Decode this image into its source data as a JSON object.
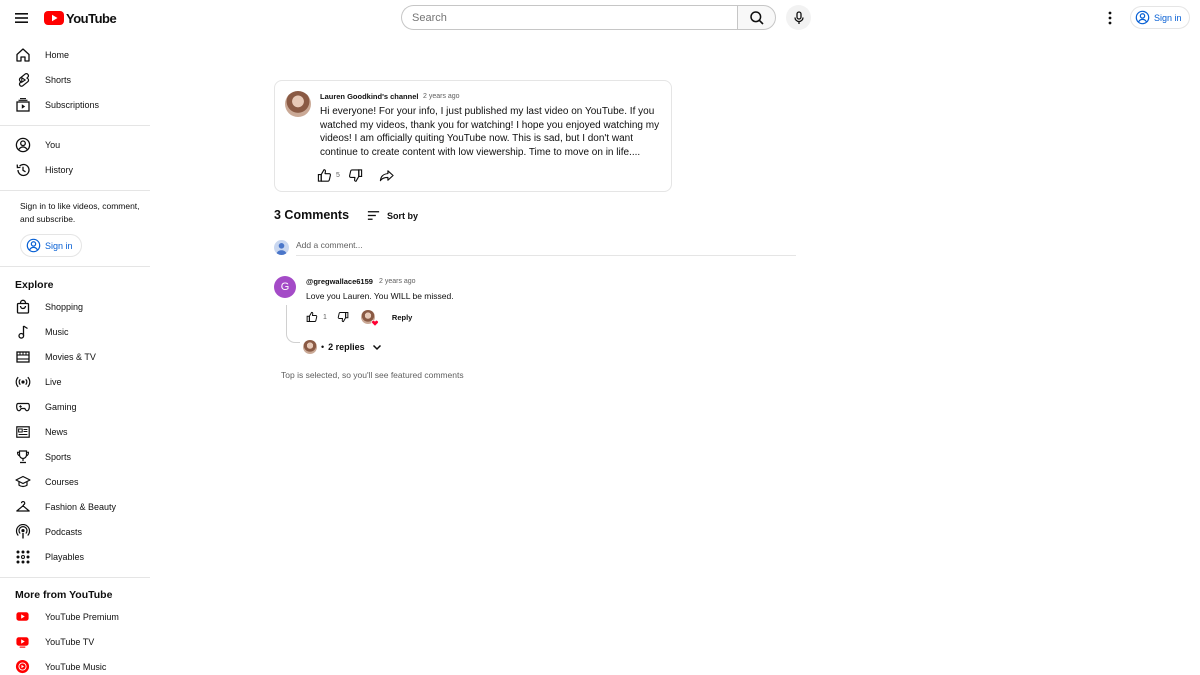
{
  "header": {
    "logo_text": "YouTube",
    "search_placeholder": "Search",
    "signin_label": "Sign in",
    "brand_color": "#ff0000",
    "link_color": "#065fd4"
  },
  "sidebar": {
    "primary": [
      {
        "label": "Home",
        "icon": "home-icon"
      },
      {
        "label": "Shorts",
        "icon": "shorts-icon"
      },
      {
        "label": "Subscriptions",
        "icon": "subscriptions-icon"
      }
    ],
    "you": [
      {
        "label": "You",
        "icon": "account-icon"
      },
      {
        "label": "History",
        "icon": "history-icon"
      }
    ],
    "signin_prompt": "Sign in to like videos, comment, and subscribe.",
    "signin_label": "Sign in",
    "explore_title": "Explore",
    "explore": [
      {
        "label": "Shopping",
        "icon": "shopping-icon"
      },
      {
        "label": "Music",
        "icon": "music-icon"
      },
      {
        "label": "Movies & TV",
        "icon": "movies-icon"
      },
      {
        "label": "Live",
        "icon": "live-icon"
      },
      {
        "label": "Gaming",
        "icon": "gaming-icon"
      },
      {
        "label": "News",
        "icon": "news-icon"
      },
      {
        "label": "Sports",
        "icon": "sports-icon"
      },
      {
        "label": "Courses",
        "icon": "courses-icon"
      },
      {
        "label": "Fashion & Beauty",
        "icon": "fashion-icon"
      },
      {
        "label": "Podcasts",
        "icon": "podcasts-icon"
      },
      {
        "label": "Playables",
        "icon": "playables-icon"
      }
    ],
    "more_title": "More from YouTube",
    "more": [
      {
        "label": "YouTube Premium",
        "icon": "youtube-premium-icon"
      },
      {
        "label": "YouTube TV",
        "icon": "youtube-tv-icon"
      },
      {
        "label": "YouTube Music",
        "icon": "youtube-music-icon"
      }
    ]
  },
  "post": {
    "author": "Lauren Goodkind's channel",
    "time": "2 years ago",
    "text": "Hi everyone!  For your info, I just published my last video on YouTube.  If you watched my videos, thank you for watching! I hope you enjoyed watching my videos!    I am officially quiting YouTube now.  This is sad, but I don't want continue to create content with low viewership.  Time to move on in life....",
    "like_count": "5"
  },
  "comments": {
    "count_label": "3 Comments",
    "sort_label": "Sort by",
    "add_placeholder": "Add a comment...",
    "items": [
      {
        "avatar_letter": "G",
        "author": "@gregwallace6159",
        "time": "2 years ago",
        "text": "Love you Lauren. You WILL be missed.",
        "like_count": "1",
        "reply_label": "Reply",
        "replies_label": "2 replies"
      }
    ],
    "featured_note": "Top is selected, so you'll see featured comments"
  }
}
